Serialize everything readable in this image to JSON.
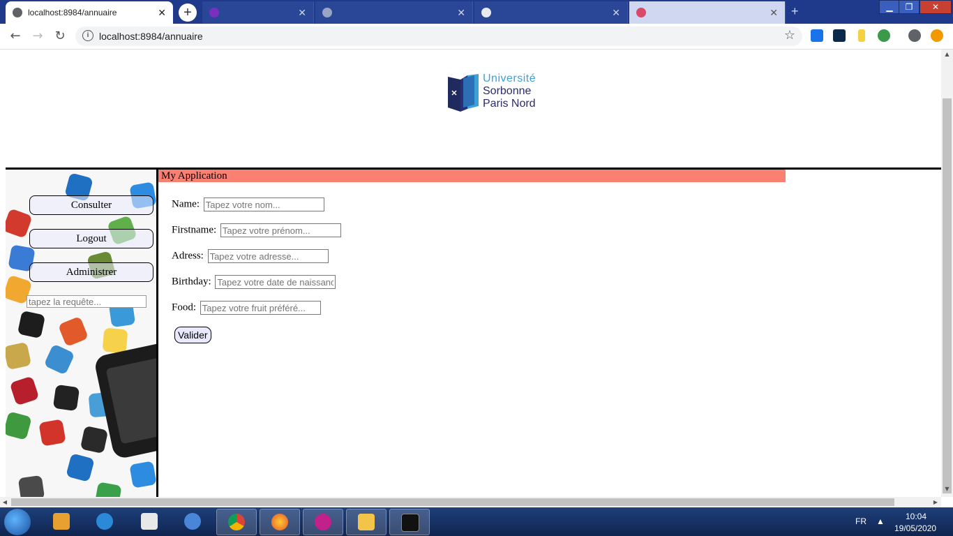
{
  "browser": {
    "active_tab": {
      "title": "localhost:8984/annuaire",
      "close": "✕"
    },
    "other_tabs": [
      {
        "title": "",
        "close": "✕"
      },
      {
        "title": "",
        "close": "✕"
      },
      {
        "title": "",
        "close": "✕"
      },
      {
        "title": "",
        "close": "✕"
      }
    ],
    "new_tab": "+",
    "window_controls": {
      "minimize": "▁",
      "maximize": "❐",
      "close": "✕"
    },
    "nav": {
      "back": "←",
      "forward": "→",
      "reload": "↻"
    },
    "address": "localhost:8984/annuaire",
    "info_icon": "i",
    "bookmark_icon": "☆"
  },
  "header": {
    "logo_line1": "Université",
    "logo_line2": "Sorbonne",
    "logo_line3": "Paris Nord"
  },
  "sidebar": {
    "buttons": [
      {
        "label": "Consulter"
      },
      {
        "label": "Logout"
      },
      {
        "label": "Administrer"
      }
    ],
    "search_placeholder": "tapez la requête..."
  },
  "main": {
    "app_title": "My Application",
    "fields": [
      {
        "label": "Name:",
        "placeholder": "Tapez votre nom..."
      },
      {
        "label": "Firstname:",
        "placeholder": "Tapez votre prénom..."
      },
      {
        "label": "Adress:",
        "placeholder": "Tapez votre adresse..."
      },
      {
        "label": "Birthday:",
        "placeholder": "Tapez votre date de naissance..."
      },
      {
        "label": "Food:",
        "placeholder": "Tapez votre fruit préféré..."
      }
    ],
    "submit_label": "Valider"
  },
  "taskbar": {
    "language": "FR",
    "time": "10:04",
    "date": "19/05/2020"
  },
  "colors": {
    "app_bar": "#fa8072",
    "chrome_frame": "#1f3a8a",
    "taskbar": "#1e3f7a"
  }
}
